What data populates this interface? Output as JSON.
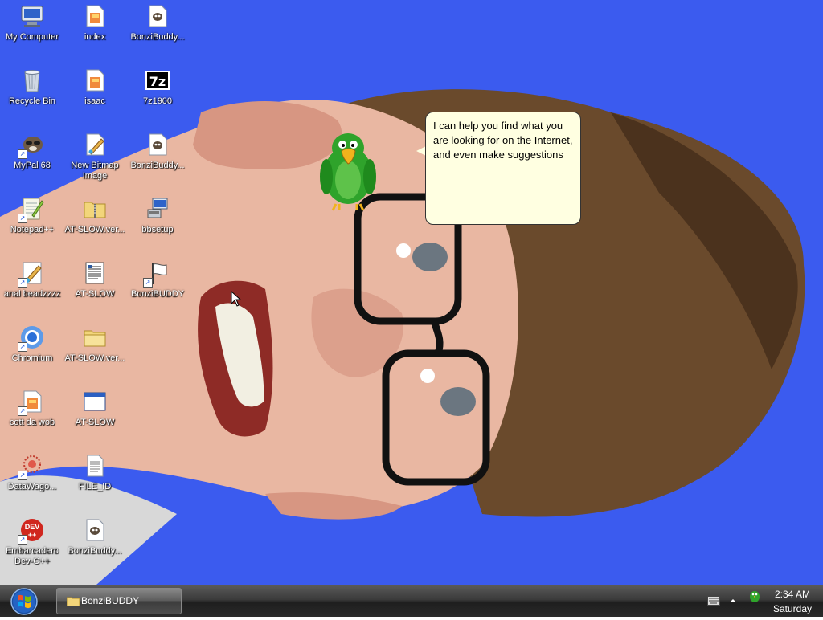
{
  "desktop": {
    "icons": [
      {
        "label": "My Computer",
        "icon": "computer-icon"
      },
      {
        "label": "Recycle Bin",
        "icon": "recycle-bin-icon"
      },
      {
        "label": "MyPal 68",
        "icon": "mypal-browser-icon"
      },
      {
        "label": "Notepad++",
        "icon": "notepad-plus-plus-icon"
      },
      {
        "label": "anal beadzzzz",
        "icon": "paint-shortcut-icon"
      },
      {
        "label": "Chromium",
        "icon": "chromium-icon"
      },
      {
        "label": "cott da wob",
        "icon": "web-document-shortcut-icon"
      },
      {
        "label": "DataWago...",
        "icon": "datawagon-icon"
      },
      {
        "label": "Embarcadero\nDev-C++",
        "icon": "devcpp-icon"
      },
      {
        "label": "index",
        "icon": "html-document-icon"
      },
      {
        "label": "isaac",
        "icon": "html-document-icon"
      },
      {
        "label": "New Bitmap\nImage",
        "icon": "bitmap-icon"
      },
      {
        "label": "AT-SLOW.ver...",
        "icon": "zip-folder-icon"
      },
      {
        "label": "AT-SLOW",
        "icon": "text-document-icon"
      },
      {
        "label": "AT-SLOW.ver...",
        "icon": "folder-icon"
      },
      {
        "label": "AT-SLOW",
        "icon": "application-window-icon"
      },
      {
        "label": "FILE_ID",
        "icon": "text-file-icon"
      },
      {
        "label": "BonziBuddy...",
        "icon": "bonzi-file-icon"
      },
      {
        "label": "BonziBuddy...",
        "icon": "bonzi-file-icon"
      },
      {
        "label": "7z1900",
        "icon": "7zip-icon"
      },
      {
        "label": "BonziBuddy...",
        "icon": "bonzi-file-icon"
      },
      {
        "label": "bbsetup",
        "icon": "setup-installer-icon"
      },
      {
        "label": "BonziBUDDY",
        "icon": "bonzi-flag-shortcut-icon"
      }
    ]
  },
  "bonzi": {
    "speech": "I can help you find what you are looking for on the Internet, and even make suggestions"
  },
  "taskbar": {
    "start_icon": "windows-start-orb-icon",
    "task_label": "BonziBUDDY",
    "tray": {
      "time": "2:34 AM",
      "day": "Saturday"
    }
  },
  "colors": {
    "wallpaper_blue": "#3b5bef",
    "balloon_bg": "#ffffe1",
    "taskbar": "#2b2b2b",
    "bonzi_green": "#2fa32b"
  }
}
